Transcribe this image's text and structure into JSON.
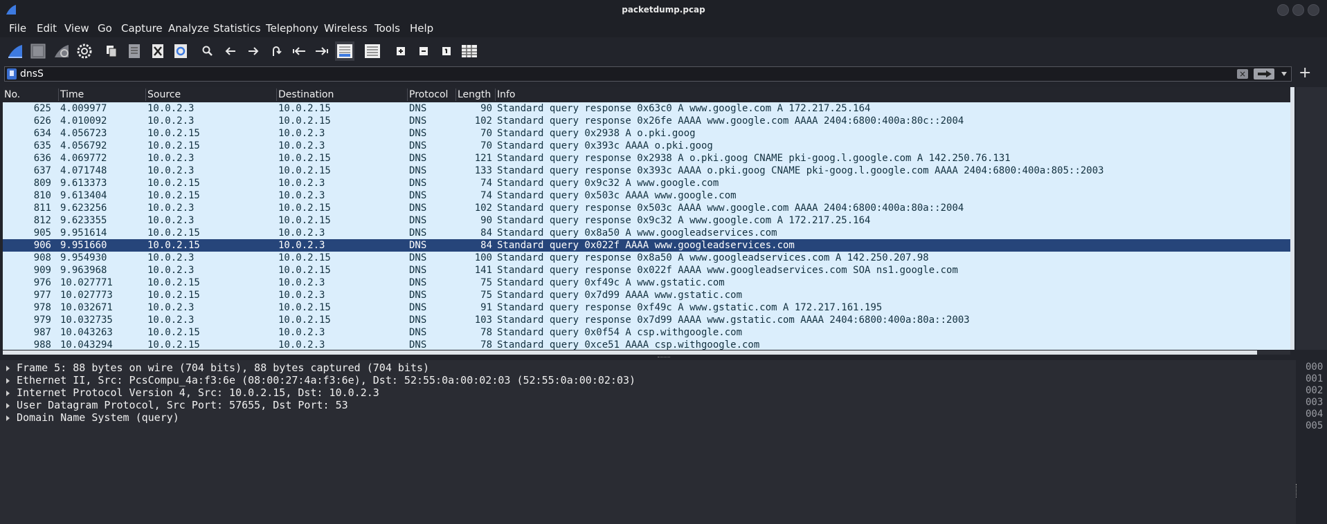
{
  "window": {
    "title": "packetdump.pcap"
  },
  "menu": [
    "File",
    "Edit",
    "View",
    "Go",
    "Capture",
    "Analyze",
    "Statistics",
    "Telephony",
    "Wireless",
    "Tools",
    "Help"
  ],
  "toolbar": [
    "shark-fin-start-icon",
    "stop-square-icon",
    "restart-fin-icon",
    "gear-options-icon",
    "open-file-icon",
    "save-file-icon",
    "close-file-icon",
    "reload-file-icon",
    "search-icon",
    "arrow-left-icon",
    "arrow-right-icon",
    "go-to-packet-icon",
    "first-packet-icon",
    "last-packet-icon",
    "autoscroll-icon",
    "colorize-icon",
    "zoom-in-icon",
    "zoom-out-icon",
    "normal-size-icon",
    "resize-columns-icon"
  ],
  "filter": {
    "value": "dnsS"
  },
  "packet_list": {
    "columns": [
      "No.",
      "Time",
      "Source",
      "Destination",
      "Protocol",
      "Length",
      "Info"
    ],
    "rows": [
      {
        "no": "625",
        "time": "4.009977",
        "src": "10.0.2.3",
        "dst": "10.0.2.15",
        "proto": "DNS",
        "len": "90",
        "info": "Standard query response 0x63c0 A www.google.com A 172.217.25.164"
      },
      {
        "no": "626",
        "time": "4.010092",
        "src": "10.0.2.3",
        "dst": "10.0.2.15",
        "proto": "DNS",
        "len": "102",
        "info": "Standard query response 0x26fe AAAA www.google.com AAAA 2404:6800:400a:80c::2004"
      },
      {
        "no": "634",
        "time": "4.056723",
        "src": "10.0.2.15",
        "dst": "10.0.2.3",
        "proto": "DNS",
        "len": "70",
        "info": "Standard query 0x2938 A o.pki.goog"
      },
      {
        "no": "635",
        "time": "4.056792",
        "src": "10.0.2.15",
        "dst": "10.0.2.3",
        "proto": "DNS",
        "len": "70",
        "info": "Standard query 0x393c AAAA o.pki.goog"
      },
      {
        "no": "636",
        "time": "4.069772",
        "src": "10.0.2.3",
        "dst": "10.0.2.15",
        "proto": "DNS",
        "len": "121",
        "info": "Standard query response 0x2938 A o.pki.goog CNAME pki-goog.l.google.com A 142.250.76.131"
      },
      {
        "no": "637",
        "time": "4.071748",
        "src": "10.0.2.3",
        "dst": "10.0.2.15",
        "proto": "DNS",
        "len": "133",
        "info": "Standard query response 0x393c AAAA o.pki.goog CNAME pki-goog.l.google.com AAAA 2404:6800:400a:805::2003"
      },
      {
        "no": "809",
        "time": "9.613373",
        "src": "10.0.2.15",
        "dst": "10.0.2.3",
        "proto": "DNS",
        "len": "74",
        "info": "Standard query 0x9c32 A www.google.com"
      },
      {
        "no": "810",
        "time": "9.613404",
        "src": "10.0.2.15",
        "dst": "10.0.2.3",
        "proto": "DNS",
        "len": "74",
        "info": "Standard query 0x503c AAAA www.google.com"
      },
      {
        "no": "811",
        "time": "9.623256",
        "src": "10.0.2.3",
        "dst": "10.0.2.15",
        "proto": "DNS",
        "len": "102",
        "info": "Standard query response 0x503c AAAA www.google.com AAAA 2404:6800:400a:80a::2004"
      },
      {
        "no": "812",
        "time": "9.623355",
        "src": "10.0.2.3",
        "dst": "10.0.2.15",
        "proto": "DNS",
        "len": "90",
        "info": "Standard query response 0x9c32 A www.google.com A 172.217.25.164"
      },
      {
        "no": "905",
        "time": "9.951614",
        "src": "10.0.2.15",
        "dst": "10.0.2.3",
        "proto": "DNS",
        "len": "84",
        "info": "Standard query 0x8a50 A www.googleadservices.com"
      },
      {
        "no": "906",
        "time": "9.951660",
        "src": "10.0.2.15",
        "dst": "10.0.2.3",
        "proto": "DNS",
        "len": "84",
        "info": "Standard query 0x022f AAAA www.googleadservices.com",
        "selected": true
      },
      {
        "no": "908",
        "time": "9.954930",
        "src": "10.0.2.3",
        "dst": "10.0.2.15",
        "proto": "DNS",
        "len": "100",
        "info": "Standard query response 0x8a50 A www.googleadservices.com A 142.250.207.98"
      },
      {
        "no": "909",
        "time": "9.963968",
        "src": "10.0.2.3",
        "dst": "10.0.2.15",
        "proto": "DNS",
        "len": "141",
        "info": "Standard query response 0x022f AAAA www.googleadservices.com SOA ns1.google.com"
      },
      {
        "no": "976",
        "time": "10.027771",
        "src": "10.0.2.15",
        "dst": "10.0.2.3",
        "proto": "DNS",
        "len": "75",
        "info": "Standard query 0xf49c A www.gstatic.com"
      },
      {
        "no": "977",
        "time": "10.027773",
        "src": "10.0.2.15",
        "dst": "10.0.2.3",
        "proto": "DNS",
        "len": "75",
        "info": "Standard query 0x7d99 AAAA www.gstatic.com"
      },
      {
        "no": "978",
        "time": "10.032671",
        "src": "10.0.2.3",
        "dst": "10.0.2.15",
        "proto": "DNS",
        "len": "91",
        "info": "Standard query response 0xf49c A www.gstatic.com A 172.217.161.195"
      },
      {
        "no": "979",
        "time": "10.032735",
        "src": "10.0.2.3",
        "dst": "10.0.2.15",
        "proto": "DNS",
        "len": "103",
        "info": "Standard query response 0x7d99 AAAA www.gstatic.com AAAA 2404:6800:400a:80a::2003"
      },
      {
        "no": "987",
        "time": "10.043263",
        "src": "10.0.2.15",
        "dst": "10.0.2.3",
        "proto": "DNS",
        "len": "78",
        "info": "Standard query 0x0f54 A csp.withgoogle.com"
      },
      {
        "no": "988",
        "time": "10.043294",
        "src": "10.0.2.15",
        "dst": "10.0.2.3",
        "proto": "DNS",
        "len": "78",
        "info": "Standard query 0xce51 AAAA csp.withgoogle.com"
      }
    ]
  },
  "details": [
    "Frame 5: 88 bytes on wire (704 bits), 88 bytes captured (704 bits)",
    "Ethernet II, Src: PcsCompu_4a:f3:6e (08:00:27:4a:f3:6e), Dst: 52:55:0a:00:02:03 (52:55:0a:00:02:03)",
    "Internet Protocol Version 4, Src: 10.0.2.15, Dst: 10.0.2.3",
    "User Datagram Protocol, Src Port: 57655, Dst Port: 53",
    "Domain Name System (query)"
  ],
  "bytes_offsets": [
    "000",
    "001",
    "002",
    "003",
    "004",
    "005"
  ],
  "colors": {
    "row_bg": "#dbeefc",
    "row_selected": "#26457a",
    "accent": "#3b6fd0"
  }
}
